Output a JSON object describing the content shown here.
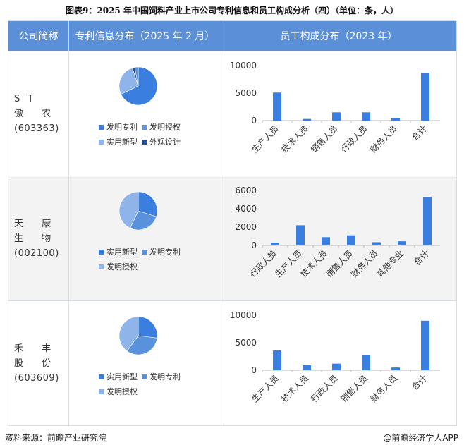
{
  "title": "图表9：2025 年中国饲料产业上市公司专利信息和员工构成分析（四）（单位：条，人）",
  "headers": [
    "公司简称",
    "专利信息分布（2025 年 2 月）",
    "员工构成分布（2023 年）"
  ],
  "companies": [
    {
      "name": "ST 傲 农",
      "code": "(603363)"
    },
    {
      "name": "天 康 生 物",
      "code": "(002100)"
    },
    {
      "name": "禾 丰 股 份",
      "code": "(603609)"
    }
  ],
  "colors": {
    "header": "#5b8fd8",
    "bar": "#3a7fe0",
    "pie_dark_blue": "#1f4e96",
    "pie_mid_blue": "#3a7fe0",
    "pie_light_blue": "#5a91dd",
    "pie_pale_blue": "#8fb4ea"
  },
  "chart_data": [
    {
      "type": "pie",
      "company": "ST 傲 农",
      "slices": [
        {
          "name": "发明专利",
          "value": 68,
          "color": "#3a7fe0"
        },
        {
          "name": "实用新型",
          "value": 27,
          "color": "#8fb4ea"
        },
        {
          "name": "外观设计",
          "value": 2,
          "color": "#1f4e96"
        },
        {
          "name": "发明授权",
          "value": 3,
          "color": "#5a91dd"
        }
      ],
      "legend": [
        "发明专利",
        "发明授权",
        "实用新型",
        "外观设计"
      ]
    },
    {
      "type": "bar",
      "company": "ST 傲 农",
      "categories": [
        "生产人员",
        "技术人员",
        "销售人员",
        "行政人员",
        "财务人员",
        "合计"
      ],
      "values": [
        5100,
        300,
        1500,
        1500,
        400,
        8700
      ],
      "ylim": [
        0,
        10000
      ],
      "yticks": [
        0,
        5000,
        10000
      ]
    },
    {
      "type": "pie",
      "company": "天 康 生 物",
      "slices": [
        {
          "name": "实用新型",
          "value": 30,
          "color": "#3a7fe0"
        },
        {
          "name": "发明专利",
          "value": 27,
          "color": "#5a91dd"
        },
        {
          "name": "发明授权",
          "value": 43,
          "color": "#8fb4ea"
        }
      ],
      "legend": [
        "实用新型",
        "发明专利",
        "发明授权"
      ]
    },
    {
      "type": "bar",
      "company": "天 康 生 物",
      "categories": [
        "行政人员",
        "生产人员",
        "技术人员",
        "销售人员",
        "财务人员",
        "其他专业",
        "合计"
      ],
      "values": [
        300,
        2200,
        900,
        1100,
        350,
        450,
        5300
      ],
      "ylim": [
        0,
        6000
      ],
      "yticks": [
        0,
        2000,
        4000,
        6000
      ]
    },
    {
      "type": "pie",
      "company": "禾 丰 股 份",
      "slices": [
        {
          "name": "实用新型",
          "value": 27,
          "color": "#3a7fe0"
        },
        {
          "name": "发明专利",
          "value": 33,
          "color": "#5a91dd"
        },
        {
          "name": "发明授权",
          "value": 40,
          "color": "#8fb4ea"
        }
      ],
      "legend": [
        "实用新型",
        "发明专利",
        "发明授权"
      ]
    },
    {
      "type": "bar",
      "company": "禾 丰 股 份",
      "categories": [
        "生产人员",
        "技术人员",
        "行政人员",
        "销售人员",
        "财务人员",
        "合计"
      ],
      "values": [
        3600,
        900,
        1200,
        2700,
        500,
        9000
      ],
      "ylim": [
        0,
        10000
      ],
      "yticks": [
        0,
        5000,
        10000
      ]
    }
  ],
  "footer": {
    "source": "资料来源：前瞻产业研究院",
    "brand": "@前瞻经济学人APP"
  }
}
